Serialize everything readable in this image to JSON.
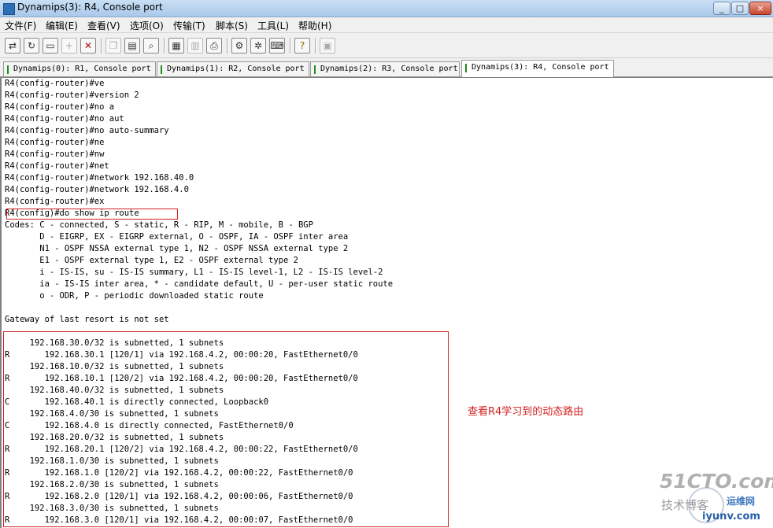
{
  "window": {
    "title": "Dynamips(3): R4, Console port",
    "buttons": [
      "_",
      "□",
      "×"
    ]
  },
  "menu": [
    "文件(F)",
    "编辑(E)",
    "查看(V)",
    "选项(O)",
    "传输(T)",
    "脚本(S)",
    "工具(L)",
    "帮助(H)"
  ],
  "toolbar_icons": [
    "connect-icon",
    "reconnect-icon",
    "disconnect-icon",
    "new-session-icon",
    "close-session-icon",
    "copy-icon",
    "paste-icon",
    "find-icon",
    "print-setup-icon",
    "print-icon",
    "printer-icon",
    "session-options-icon",
    "global-options-icon",
    "keymap-icon",
    "help-icon",
    "sftp-icon"
  ],
  "tabs": [
    {
      "label": "Dynamips(0): R1, Console port",
      "active": false
    },
    {
      "label": "Dynamips(1): R2, Console port",
      "active": false
    },
    {
      "label": "Dynamips(2): R3, Console port",
      "active": false
    },
    {
      "label": "Dynamips(3): R4, Console port",
      "active": true
    }
  ],
  "console_lines": [
    "R4(config-router)#ve",
    "R4(config-router)#version 2",
    "R4(config-router)#no a",
    "R4(config-router)#no aut",
    "R4(config-router)#no auto-summary",
    "R4(config-router)#ne",
    "R4(config-router)#nw",
    "R4(config-router)#net",
    "R4(config-router)#network 192.168.40.0",
    "R4(config-router)#network 192.168.4.0",
    "R4(config-router)#ex",
    "R4(config)#do show ip route",
    "Codes: C - connected, S - static, R - RIP, M - mobile, B - BGP",
    "       D - EIGRP, EX - EIGRP external, O - OSPF, IA - OSPF inter area",
    "       N1 - OSPF NSSA external type 1, N2 - OSPF NSSA external type 2",
    "       E1 - OSPF external type 1, E2 - OSPF external type 2",
    "       i - IS-IS, su - IS-IS summary, L1 - IS-IS level-1, L2 - IS-IS level-2",
    "       ia - IS-IS inter area, * - candidate default, U - per-user static route",
    "       o - ODR, P - periodic downloaded static route",
    "",
    "Gateway of last resort is not set",
    "",
    "     192.168.30.0/32 is subnetted, 1 subnets",
    "R       192.168.30.1 [120/1] via 192.168.4.2, 00:00:20, FastEthernet0/0",
    "     192.168.10.0/32 is subnetted, 1 subnets",
    "R       192.168.10.1 [120/2] via 192.168.4.2, 00:00:20, FastEthernet0/0",
    "     192.168.40.0/32 is subnetted, 1 subnets",
    "C       192.168.40.1 is directly connected, Loopback0",
    "     192.168.4.0/30 is subnetted, 1 subnets",
    "C       192.168.4.0 is directly connected, FastEthernet0/0",
    "     192.168.20.0/32 is subnetted, 1 subnets",
    "R       192.168.20.1 [120/2] via 192.168.4.2, 00:00:22, FastEthernet0/0",
    "     192.168.1.0/30 is subnetted, 1 subnets",
    "R       192.168.1.0 [120/2] via 192.168.4.2, 00:00:22, FastEthernet0/0",
    "     192.168.2.0/30 is subnetted, 1 subnets",
    "R       192.168.2.0 [120/1] via 192.168.4.2, 00:00:06, FastEthernet0/0",
    "     192.168.3.0/30 is subnetted, 1 subnets",
    "R       192.168.3.0 [120/1] via 192.168.4.2, 00:00:07, FastEthernet0/0"
  ],
  "annotation": {
    "note": "查看R4学习到的动态路由",
    "color": "#d22020"
  },
  "watermark": {
    "site": "51CTO.com",
    "blog": "技术博客",
    "brand": "运维网",
    "url": "iyunv.com"
  }
}
